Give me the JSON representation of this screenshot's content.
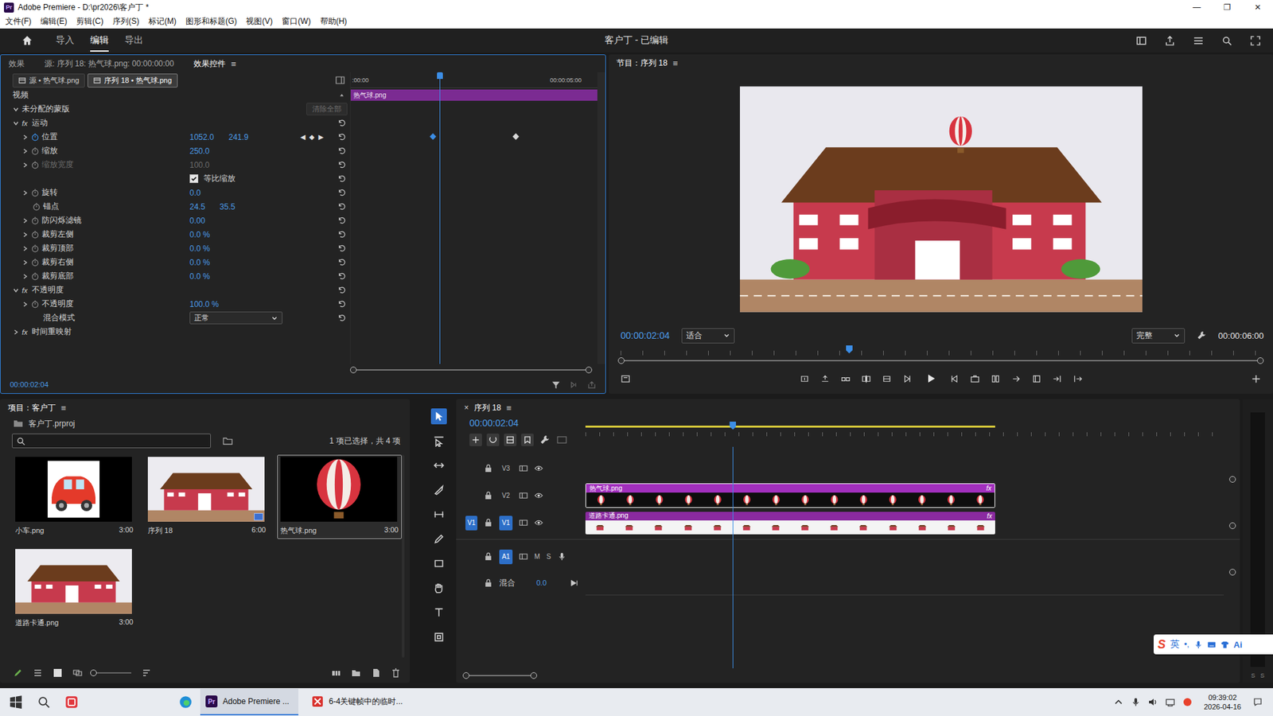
{
  "window": {
    "title": "Adobe Premiere - D:\\pr2026\\客户丁 *",
    "app_badge": "Pr",
    "controls": [
      "—",
      "❐",
      "✕"
    ]
  },
  "menu": [
    "文件(F)",
    "编辑(E)",
    "剪辑(C)",
    "序列(S)",
    "标记(M)",
    "图形和标题(G)",
    "视图(V)",
    "窗口(W)",
    "帮助(H)"
  ],
  "workspace": {
    "tabs": [
      {
        "label": "导入",
        "selected": false
      },
      {
        "label": "编辑",
        "selected": true
      },
      {
        "label": "导出",
        "selected": false
      }
    ],
    "project_title": "客户丁 - 已编辑"
  },
  "effect_controls": {
    "tabs": [
      {
        "label": "效果",
        "selected": false
      },
      {
        "label": "源: 序列 18: 热气球.png: 00:00:00:00",
        "selected": false
      },
      {
        "label": "效果控件",
        "selected": true
      }
    ],
    "menu_glyph": "≡",
    "clip_tabs": [
      {
        "label": "源 • 热气球.png",
        "selected": false
      },
      {
        "label": "序列 18 • 热气球.png",
        "selected": true
      }
    ],
    "section": "视频",
    "rows": [
      {
        "kind": "mask",
        "label": "未分配的蒙版",
        "button": "清除全部",
        "expanded": true,
        "disabled": false,
        "reset": false
      },
      {
        "kind": "section",
        "label": "运动",
        "badge": "fx",
        "expanded": true,
        "disabled": false,
        "reset": true
      },
      {
        "kind": "prop",
        "label": "位置",
        "values": [
          "1052.0",
          "241.9"
        ],
        "nav": [
          "◀",
          "◆",
          "▶"
        ],
        "expandable": true,
        "expanded": false,
        "animated": true,
        "disabled": false,
        "reset": true
      },
      {
        "kind": "prop",
        "label": "缩放",
        "values": [
          "250.0"
        ],
        "nav": [],
        "expandable": true,
        "expanded": false,
        "animated": false,
        "disabled": false,
        "reset": true
      },
      {
        "kind": "prop",
        "label": "缩放宽度",
        "values": [
          "100.0"
        ],
        "nav": [],
        "expandable": true,
        "expanded": false,
        "animated": false,
        "disabled": true,
        "reset": true
      },
      {
        "kind": "check",
        "label": "等比缩放",
        "checked": true,
        "expanded": false,
        "disabled": false,
        "reset": true
      },
      {
        "kind": "prop",
        "label": "旋转",
        "values": [
          "0.0"
        ],
        "nav": [],
        "expandable": true,
        "expanded": false,
        "animated": false,
        "disabled": false,
        "reset": true
      },
      {
        "kind": "prop",
        "label": "锚点",
        "values": [
          "24.5",
          "35.5"
        ],
        "nav": [],
        "expandable": false,
        "expanded": false,
        "animated": false,
        "disabled": false,
        "reset": true
      },
      {
        "kind": "prop",
        "label": "防闪烁滤镜",
        "values": [
          "0.00"
        ],
        "nav": [],
        "expandable": true,
        "expanded": false,
        "animated": false,
        "disabled": false,
        "reset": true
      },
      {
        "kind": "prop",
        "label": "裁剪左侧",
        "values": [
          "0.0 %"
        ],
        "nav": [],
        "expandable": true,
        "expanded": false,
        "animated": false,
        "disabled": false,
        "reset": true
      },
      {
        "kind": "prop",
        "label": "裁剪顶部",
        "values": [
          "0.0 %"
        ],
        "nav": [],
        "expandable": true,
        "expanded": false,
        "animated": false,
        "disabled": false,
        "reset": true
      },
      {
        "kind": "prop",
        "label": "裁剪右侧",
        "values": [
          "0.0 %"
        ],
        "nav": [],
        "expandable": true,
        "expanded": false,
        "animated": false,
        "disabled": false,
        "reset": true
      },
      {
        "kind": "prop",
        "label": "裁剪底部",
        "values": [
          "0.0 %"
        ],
        "nav": [],
        "expandable": true,
        "expanded": false,
        "animated": false,
        "disabled": false,
        "reset": true
      },
      {
        "kind": "section",
        "label": "不透明度",
        "badge": "fx",
        "expanded": true,
        "disabled": false,
        "reset": true
      },
      {
        "kind": "prop",
        "label": "不透明度",
        "values": [
          "100.0 %"
        ],
        "nav": [],
        "expandable": true,
        "expanded": false,
        "animated": false,
        "disabled": false,
        "reset": true
      },
      {
        "kind": "select",
        "label": "混合模式",
        "value": "正常",
        "expanded": false,
        "disabled": false,
        "reset": true
      },
      {
        "kind": "section",
        "label": "时间重映射",
        "badge": "fx",
        "expanded": false,
        "disabled": false,
        "reset": false
      }
    ],
    "ruler": [
      ":00:00",
      "00:00:05:00"
    ],
    "clip": "热气球.png",
    "playhead": 0.36,
    "keyframes": [
      {
        "pos": 0.334,
        "selected": true
      },
      {
        "pos": 0.669,
        "selected": false
      }
    ],
    "timecode": "00:00:02:04"
  },
  "program": {
    "title": "节目：序列 18",
    "menu_glyph": "≡",
    "timecode": "00:00:02:04",
    "zoom": "适合",
    "quality": "完整",
    "duration": "00:00:06:00",
    "playhead": 0.357
  },
  "project": {
    "title": "项目：客户丁",
    "menu_glyph": "≡",
    "file": "客户丁.prproj",
    "selection": "1 项已选择，共 4 项",
    "items": [
      {
        "name": "小车.png",
        "duration": "3:00",
        "kind": "car",
        "sequence": false,
        "selected": false
      },
      {
        "name": "序列 18",
        "duration": "6:00",
        "kind": "house",
        "sequence": true,
        "selected": false
      },
      {
        "name": "热气球.png",
        "duration": "3:00",
        "kind": "balloon",
        "sequence": false,
        "selected": true
      },
      {
        "name": "道路卡通.png",
        "duration": "3:00",
        "kind": "house",
        "sequence": false,
        "selected": false
      }
    ]
  },
  "tools": [
    {
      "kind": "select",
      "selected": true
    },
    {
      "kind": "track-select",
      "selected": false
    },
    {
      "kind": "ripple",
      "selected": false
    },
    {
      "kind": "razor",
      "selected": false
    },
    {
      "kind": "slip",
      "selected": false
    },
    {
      "kind": "pen",
      "selected": false
    },
    {
      "kind": "rect",
      "selected": false
    },
    {
      "kind": "hand",
      "selected": false
    },
    {
      "kind": "type",
      "selected": false
    },
    {
      "kind": "extra",
      "selected": false
    }
  ],
  "timeline": {
    "tab": "序列 18",
    "close_glyph": "×",
    "menu_glyph": "≡",
    "timecode": "00:00:02:04",
    "playhead": 0.231,
    "work_area": 0.642,
    "video_tracks": [
      {
        "name": "V3",
        "source": "",
        "targeted": false,
        "clip": null
      },
      {
        "name": "V2",
        "source": "",
        "targeted": false,
        "clip": {
          "name": "热气球.png",
          "badge": "fx",
          "kind": "balloon",
          "end": 0.642,
          "selected": true
        }
      },
      {
        "name": "V1",
        "source": "V1",
        "targeted": true,
        "clip": {
          "name": "道路卡通.png",
          "badge": "fx",
          "kind": "house",
          "end": 0.642,
          "selected": false
        }
      }
    ],
    "audio_tracks": [
      {
        "name": "A1",
        "source": "",
        "targeted": true,
        "mute": "M",
        "solo": "S"
      }
    ],
    "mix": {
      "label": "混合",
      "value": "0.0"
    }
  },
  "meter_labels": [
    "S",
    "S"
  ],
  "ime": {
    "logo": "S",
    "mode": "英",
    "punct": "•,",
    "ai": "Ai"
  },
  "taskbar": {
    "apps": [
      {
        "label": "Adobe Premiere ...",
        "kind": "premiere",
        "active": true
      },
      {
        "label": "6-4关键帧中的临时...",
        "kind": "doc",
        "active": false
      }
    ],
    "time": "09:39:02",
    "date": "2026-04-16"
  }
}
